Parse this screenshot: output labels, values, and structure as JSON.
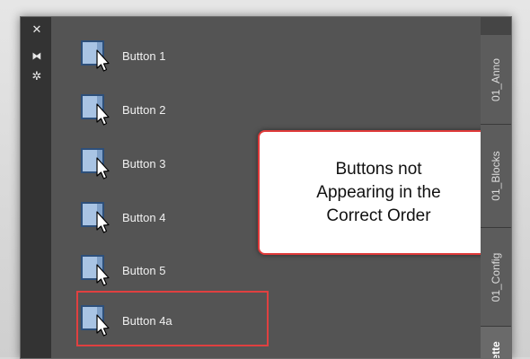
{
  "titlebar": {
    "icons": [
      {
        "name": "close-icon",
        "glyph": "✕"
      },
      {
        "name": "auto-hide-icon",
        "glyph": "⧓"
      },
      {
        "name": "properties-icon",
        "glyph": "✲"
      }
    ]
  },
  "tools": [
    {
      "label": "Button 1",
      "icon": "tool-button-icon"
    },
    {
      "label": "Button 2",
      "icon": "tool-button-icon"
    },
    {
      "label": "Button 3",
      "icon": "tool-button-icon"
    },
    {
      "label": "Button 4",
      "icon": "tool-button-icon"
    },
    {
      "label": "Button 5",
      "icon": "tool-button-icon"
    },
    {
      "label": "Button 4a",
      "icon": "tool-button-icon"
    }
  ],
  "callout": {
    "lines": [
      "Buttons not",
      "Appearing in the",
      "Correct Order"
    ],
    "border_color": "#e03a3a"
  },
  "highlight": {
    "border_color": "#e04040"
  },
  "tabs": [
    {
      "label": "01_Anno"
    },
    {
      "label": "01_Blocks"
    },
    {
      "label": "01_Config"
    },
    {
      "label": "ette"
    }
  ],
  "colors": {
    "palette_bg": "#545454",
    "icon_fill": "#9db9d8",
    "icon_frame": "#2d4f7a"
  }
}
